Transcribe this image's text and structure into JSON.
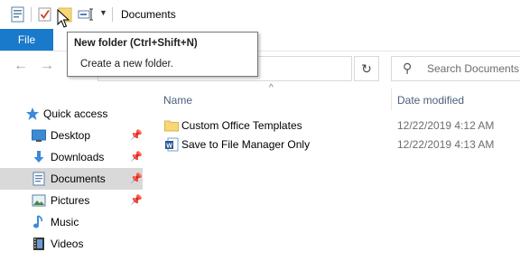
{
  "window": {
    "title": "Documents"
  },
  "ribbon": {
    "file_tab": "File"
  },
  "search": {
    "placeholder": "Search Documents"
  },
  "nav_pane": {
    "items": [
      {
        "label": "Quick access",
        "icon": "star-icon"
      },
      {
        "label": "Desktop",
        "icon": "desktop-icon",
        "pinned": true
      },
      {
        "label": "Downloads",
        "icon": "download-icon",
        "pinned": true
      },
      {
        "label": "Documents",
        "icon": "documents-icon",
        "pinned": true,
        "selected": true
      },
      {
        "label": "Pictures",
        "icon": "pictures-icon",
        "pinned": true
      },
      {
        "label": "Music",
        "icon": "music-icon"
      },
      {
        "label": "Videos",
        "icon": "videos-icon"
      }
    ]
  },
  "columns": {
    "name": "Name",
    "date_modified": "Date modified"
  },
  "files": [
    {
      "name": "Custom Office Templates",
      "date": "12/22/2019 4:12 AM",
      "icon": "folder-icon"
    },
    {
      "name": "Save to File Manager Only",
      "date": "12/22/2019 4:13 AM",
      "icon": "word-doc-icon"
    }
  ],
  "tooltip": {
    "title": "New folder (Ctrl+Shift+N)",
    "description": "Create a new folder."
  },
  "colors": {
    "accent": "#1979ca",
    "selected_bg": "#d9d9d9",
    "folder": "#f8d775"
  }
}
